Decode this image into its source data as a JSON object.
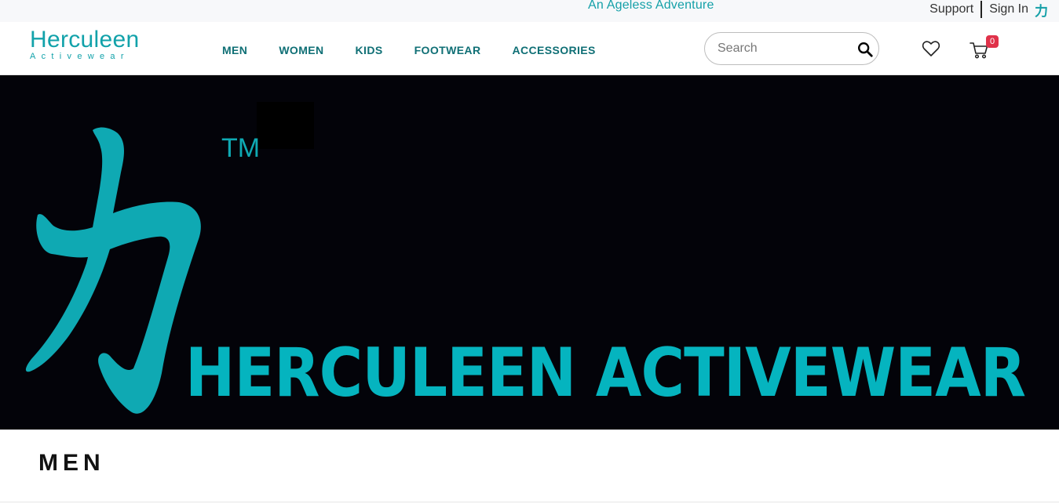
{
  "topbar": {
    "tagline": "An Ageless Adventure",
    "support_label": "Support",
    "signin_label": "Sign In",
    "glyph": "力"
  },
  "logo": {
    "main": "Herculeen",
    "sub": "Activewear"
  },
  "nav": {
    "items": [
      {
        "label": "MEN"
      },
      {
        "label": "WOMEN"
      },
      {
        "label": "KIDS"
      },
      {
        "label": "FOOTWEAR"
      },
      {
        "label": "ACCESSORIES"
      }
    ]
  },
  "search": {
    "placeholder": "Search"
  },
  "cart": {
    "count": "0"
  },
  "banner": {
    "tm": "TM",
    "title": "HERCULEEN ACTIVEWEAR"
  },
  "section": {
    "title": "MEN"
  },
  "colors": {
    "brand_teal": "#12a2aa",
    "nav_teal": "#0f6f75",
    "banner_bg": "#030309",
    "badge_red": "#e0324a"
  },
  "icons": {
    "search": "search-icon",
    "wishlist": "heart-icon",
    "cart": "cart-icon",
    "brand_glyph": "li-kanji-icon"
  }
}
